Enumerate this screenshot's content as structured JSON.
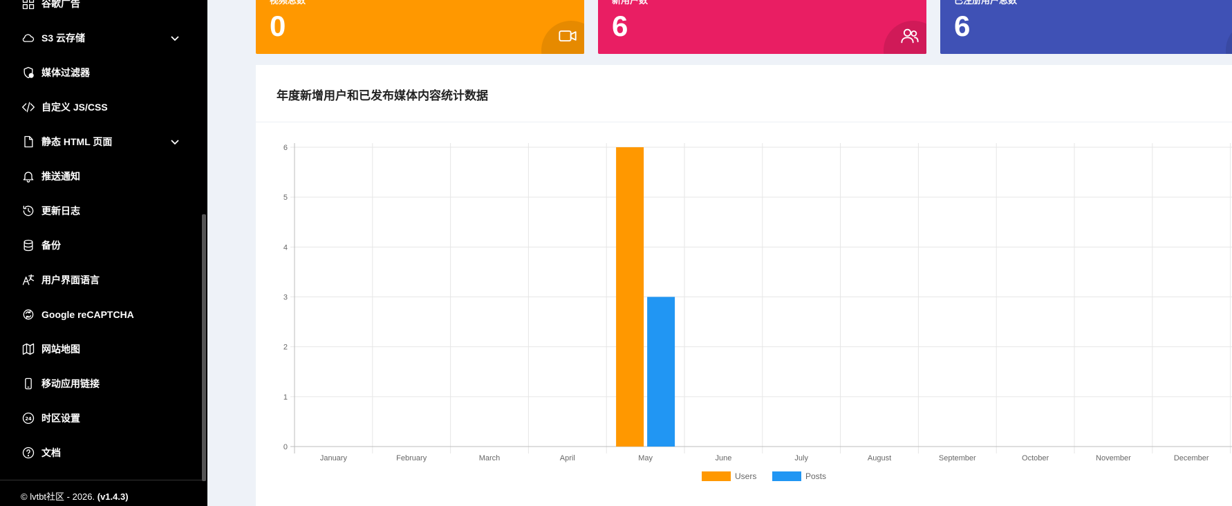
{
  "sidebar": {
    "items": [
      {
        "label": "谷歌广告",
        "icon": "grid-icon",
        "chevron": false
      },
      {
        "label": "S3 云存储",
        "icon": "cloud-icon",
        "chevron": true
      },
      {
        "label": "媒体过滤器",
        "icon": "shield-check-icon",
        "chevron": false
      },
      {
        "label": "自定义 JS/CSS",
        "icon": "code-icon",
        "chevron": false
      },
      {
        "label": "静态 HTML 页面",
        "icon": "file-icon",
        "chevron": true
      },
      {
        "label": "推送通知",
        "icon": "bell-icon",
        "chevron": false
      },
      {
        "label": "更新日志",
        "icon": "history-icon",
        "chevron": false
      },
      {
        "label": "备份",
        "icon": "database-icon",
        "chevron": false
      },
      {
        "label": "用户界面语言",
        "icon": "language-icon",
        "chevron": false
      },
      {
        "label": "Google reCAPTCHA",
        "icon": "recaptcha-icon",
        "chevron": false
      },
      {
        "label": "网站地图",
        "icon": "map-icon",
        "chevron": false
      },
      {
        "label": "移动应用链接",
        "icon": "mobile-icon",
        "chevron": false
      },
      {
        "label": "时区设置",
        "icon": "clock-24-icon",
        "chevron": false
      },
      {
        "label": "文档",
        "icon": "help-circle-icon",
        "chevron": false
      }
    ],
    "footer_prefix": "© lvtbt社区 - 2026.",
    "footer_version": "(v1.4.3)"
  },
  "cards": [
    {
      "label": "视频总数",
      "value": "0",
      "color": "#ff9800",
      "bubble": "#e68a00",
      "icon": "video-icon"
    },
    {
      "label": "新用户数",
      "value": "6",
      "color": "#e91e63",
      "bubble": "#d01a58",
      "icon": "users-icon"
    },
    {
      "label": "已注册用户总数",
      "value": "6",
      "color": "#3f51b5",
      "bubble": "#3949a3",
      "icon": "user-icon"
    }
  ],
  "panel": {
    "title": "年度新增用户和已发布媒体内容统计数据"
  },
  "chart_data": {
    "type": "bar",
    "categories": [
      "January",
      "February",
      "March",
      "April",
      "May",
      "June",
      "July",
      "August",
      "September",
      "October",
      "November",
      "December"
    ],
    "series": [
      {
        "name": "Users",
        "color": "#ff9800",
        "values": [
          0,
          0,
          0,
          0,
          6,
          0,
          0,
          0,
          0,
          0,
          0,
          0
        ]
      },
      {
        "name": "Posts",
        "color": "#2196f3",
        "values": [
          0,
          0,
          0,
          0,
          3,
          0,
          0,
          0,
          0,
          0,
          0,
          0
        ]
      }
    ],
    "ylim": [
      0,
      6
    ],
    "yticks": [
      "0",
      "1",
      "2",
      "3",
      "4",
      "5",
      "6"
    ],
    "grid": true,
    "legend": "bottom"
  }
}
